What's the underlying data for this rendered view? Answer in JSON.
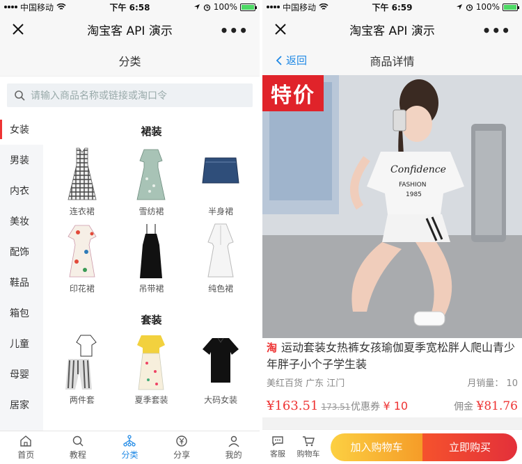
{
  "left": {
    "status": {
      "carrier": "中国移动",
      "time": "下午 6:58",
      "battery": "100%",
      "battery_level": 1.0
    },
    "app_title": "淘宝客 API 演示",
    "header": "分类",
    "search": {
      "placeholder": "请输入商品名称或链接或淘口令"
    },
    "sidebar": {
      "items": [
        {
          "label": "女装"
        },
        {
          "label": "男装"
        },
        {
          "label": "内衣"
        },
        {
          "label": "美妆"
        },
        {
          "label": "配饰"
        },
        {
          "label": "鞋品"
        },
        {
          "label": "箱包"
        },
        {
          "label": "儿童"
        },
        {
          "label": "母婴"
        },
        {
          "label": "居家"
        }
      ],
      "active": "女装"
    },
    "groups": [
      {
        "title": "裙装",
        "items": [
          {
            "label": "连衣裙",
            "icon": "plaid-dress-icon"
          },
          {
            "label": "雪纺裙",
            "icon": "chiffon-dress-icon"
          },
          {
            "label": "半身裙",
            "icon": "denim-skirt-icon"
          },
          {
            "label": "印花裙",
            "icon": "print-dress-icon"
          },
          {
            "label": "吊带裙",
            "icon": "slip-dress-icon"
          },
          {
            "label": "纯色裙",
            "icon": "white-dress-icon"
          }
        ]
      },
      {
        "title": "套装",
        "items": [
          {
            "label": "两件套",
            "icon": "two-piece-icon"
          },
          {
            "label": "夏季套装",
            "icon": "summer-set-icon"
          },
          {
            "label": "大码女装",
            "icon": "plus-size-tee-icon"
          }
        ]
      }
    ],
    "tabs": [
      {
        "label": "首页",
        "icon": "home-icon"
      },
      {
        "label": "教程",
        "icon": "search-icon"
      },
      {
        "label": "分类",
        "icon": "category-icon",
        "active": true
      },
      {
        "label": "分享",
        "icon": "share-yen-icon"
      },
      {
        "label": "我的",
        "icon": "user-icon"
      }
    ]
  },
  "right": {
    "status": {
      "carrier": "中国移动",
      "time": "下午 6:59",
      "battery": "100%",
      "battery_level": 1.0
    },
    "app_title": "淘宝客 API 演示",
    "header": "商品详情",
    "back_label": "返回",
    "badge": "特价",
    "product": {
      "platform_tag": "淘",
      "title": "运动套装女热裤女孩瑜伽夏季宽松胖人爬山青少年胖子小个子学生装",
      "shop": "美红百货",
      "location": "广东 江门",
      "sales": "月销量： 10",
      "price": "¥163.51",
      "original_price": "173.51",
      "coupon_label": "优惠券",
      "coupon_value": "¥ 10",
      "commission_label": "佣金",
      "commission_value": "¥81.76",
      "shirt_text_1": "Confidence",
      "shirt_text_2": "FASHION",
      "shirt_text_3": "1985"
    },
    "actions": {
      "service": "客服",
      "cart": "购物车",
      "add_to_cart": "加入购物车",
      "buy_now": "立即购买"
    }
  },
  "colors": {
    "accent": "#1e88e5",
    "price": "#e33333",
    "badge": "#e0232a"
  }
}
